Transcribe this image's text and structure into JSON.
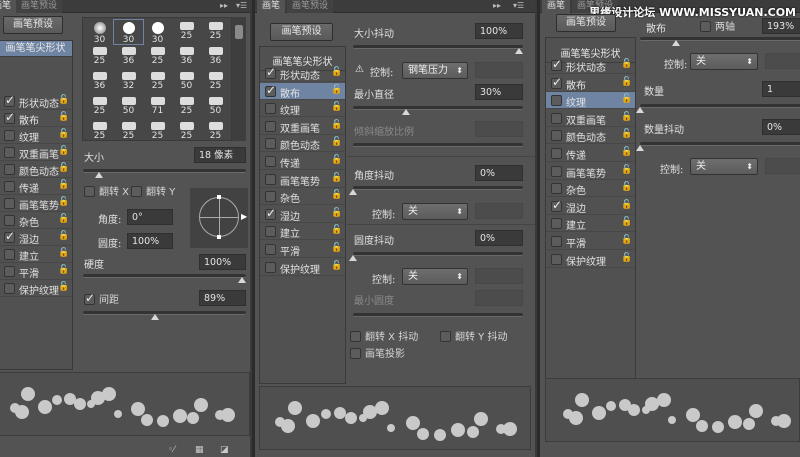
{
  "common": {
    "tab_brush": "画笔",
    "tab_presets": "画笔预设",
    "preset_button": "画笔预设",
    "tip_shape": "画笔笔尖形状",
    "lock_icon": "🔓",
    "items": [
      "形状动态",
      "散布",
      "纹理",
      "双重画笔",
      "颜色动态",
      "传递",
      "画笔笔势",
      "杂色",
      "湿边",
      "建立",
      "平滑",
      "保护纹理"
    ]
  },
  "panel1": {
    "checked": [
      true,
      true,
      false,
      false,
      false,
      false,
      false,
      false,
      true,
      false,
      false,
      false
    ],
    "brushes": [
      [
        "soft",
        30
      ],
      [
        "round",
        30
      ],
      [
        "round",
        30
      ],
      [
        "",
        25
      ],
      [
        "",
        25
      ],
      [
        "",
        25
      ],
      [
        "",
        36
      ],
      [
        "",
        25
      ],
      [
        "",
        36
      ],
      [
        "",
        36
      ],
      [
        "",
        36
      ],
      [
        "",
        32
      ],
      [
        "",
        25
      ],
      [
        "",
        50
      ],
      [
        "",
        25
      ],
      [
        "",
        25
      ],
      [
        "",
        50
      ],
      [
        "",
        71
      ],
      [
        "",
        25
      ],
      [
        "",
        50
      ],
      [
        "",
        25
      ],
      [
        "",
        25
      ],
      [
        "",
        25
      ],
      [
        "",
        25
      ],
      [
        "",
        25
      ]
    ],
    "size_label": "大小",
    "size_value": "18 像素",
    "flip_x": "翻转 X",
    "flip_y": "翻转 Y",
    "angle_label": "角度:",
    "angle_value": "0°",
    "roundness_label": "圆度:",
    "roundness_value": "100%",
    "hardness_label": "硬度",
    "hardness_value": "100%",
    "spacing_label": "间距",
    "spacing_value": "89%",
    "size_pct": 8,
    "hardness_pct": 100,
    "spacing_pct": 44
  },
  "panel2": {
    "checked": [
      true,
      true,
      false,
      false,
      false,
      false,
      false,
      false,
      true,
      false,
      false,
      false
    ],
    "size_jitter_label": "大小抖动",
    "size_jitter_value": "100%",
    "control_label": "控制:",
    "control1": "钢笔压力",
    "min_diameter_label": "最小直径",
    "min_diameter_value": "30%",
    "tilt_scale_label": "倾斜缩放比例",
    "angle_jitter_label": "角度抖动",
    "angle_jitter_value": "0%",
    "control2": "关",
    "roundness_jitter_label": "圆度抖动",
    "roundness_jitter_value": "0%",
    "control3": "关",
    "min_roundness_label": "最小圆度",
    "flip_x_jitter": "翻转 X 抖动",
    "flip_y_jitter": "翻转 Y 抖动",
    "brush_projection": "画笔投影",
    "size_jitter_pct": 100,
    "min_diameter_pct": 30
  },
  "panel3": {
    "checked": [
      true,
      true,
      false,
      false,
      false,
      false,
      false,
      false,
      true,
      false,
      false,
      false
    ],
    "scatter_label": "散布",
    "both_axes": "两轴",
    "scatter_value": "193%",
    "control_label": "控制:",
    "control1": "关",
    "count_label": "数量",
    "count_value": "1",
    "count_jitter_label": "数量抖动",
    "count_jitter_value": "0%",
    "control2": "关"
  },
  "watermark": "思缘设计论坛 WWW.MISSYUAN.COM"
}
